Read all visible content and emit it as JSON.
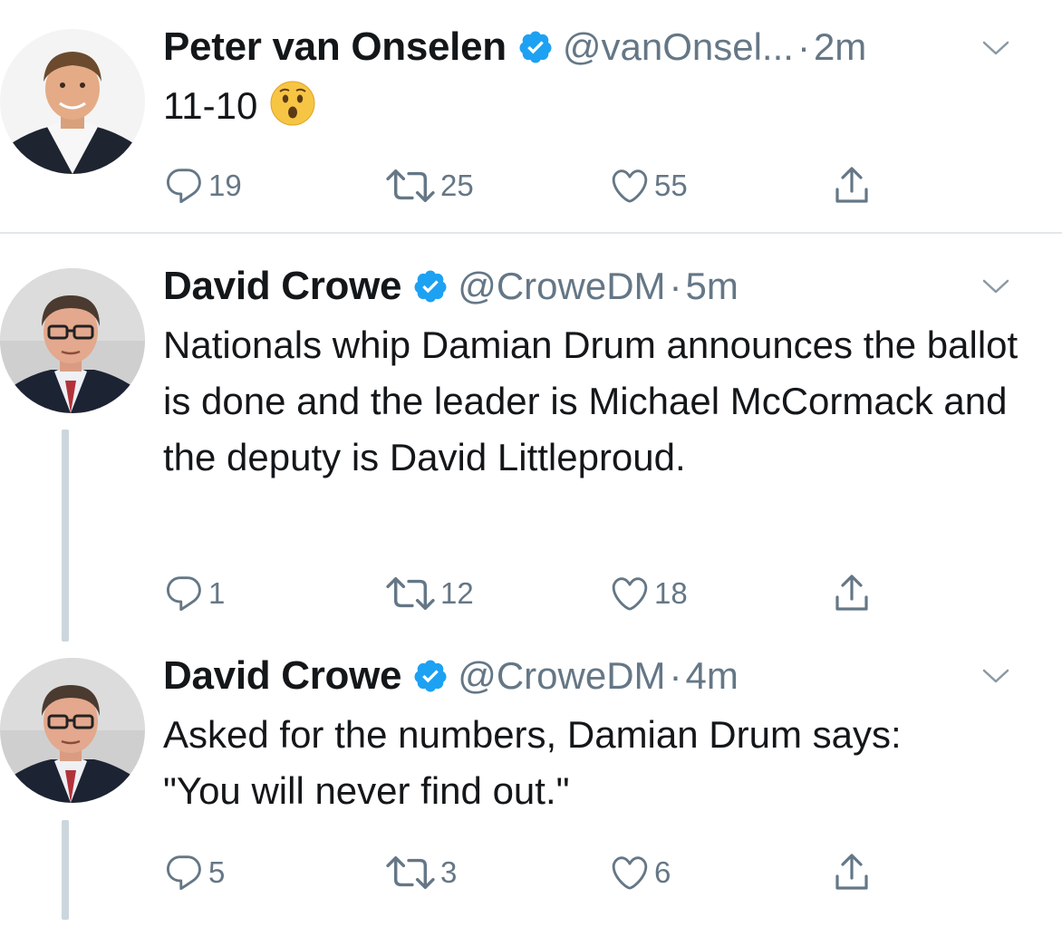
{
  "tweets": [
    {
      "name": "Peter van Onselen",
      "handle": "@vanOnsel...",
      "separator": "·",
      "time": "2m",
      "text": "11-10",
      "emoji": "hushed-face-emoji",
      "replies": "19",
      "retweets": "25",
      "likes": "55"
    },
    {
      "name": "David Crowe",
      "handle": "@CroweDM",
      "separator": "·",
      "time": "5m",
      "text": "Nationals whip Damian Drum announces the ballot is done and the leader is Michael McCormack and the deputy is David Littleproud.",
      "replies": "1",
      "retweets": "12",
      "likes": "18"
    },
    {
      "name": "David Crowe",
      "handle": "@CroweDM",
      "separator": "·",
      "time": "4m",
      "text": "Asked for the numbers, Damian Drum says: \"You will never find out.\"",
      "replies": "5",
      "retweets": "3",
      "likes": "6"
    }
  ],
  "icons": {
    "reply": "reply-icon",
    "retweet": "retweet-icon",
    "like": "like-icon",
    "share": "share-icon",
    "verified": "verified-badge-icon",
    "caret": "chevron-down-icon"
  },
  "colors": {
    "text": "#14171a",
    "secondary": "#657786",
    "verified": "#1da1f2",
    "divider": "#e1e8ed",
    "thread_line": "#ccd6dd"
  }
}
